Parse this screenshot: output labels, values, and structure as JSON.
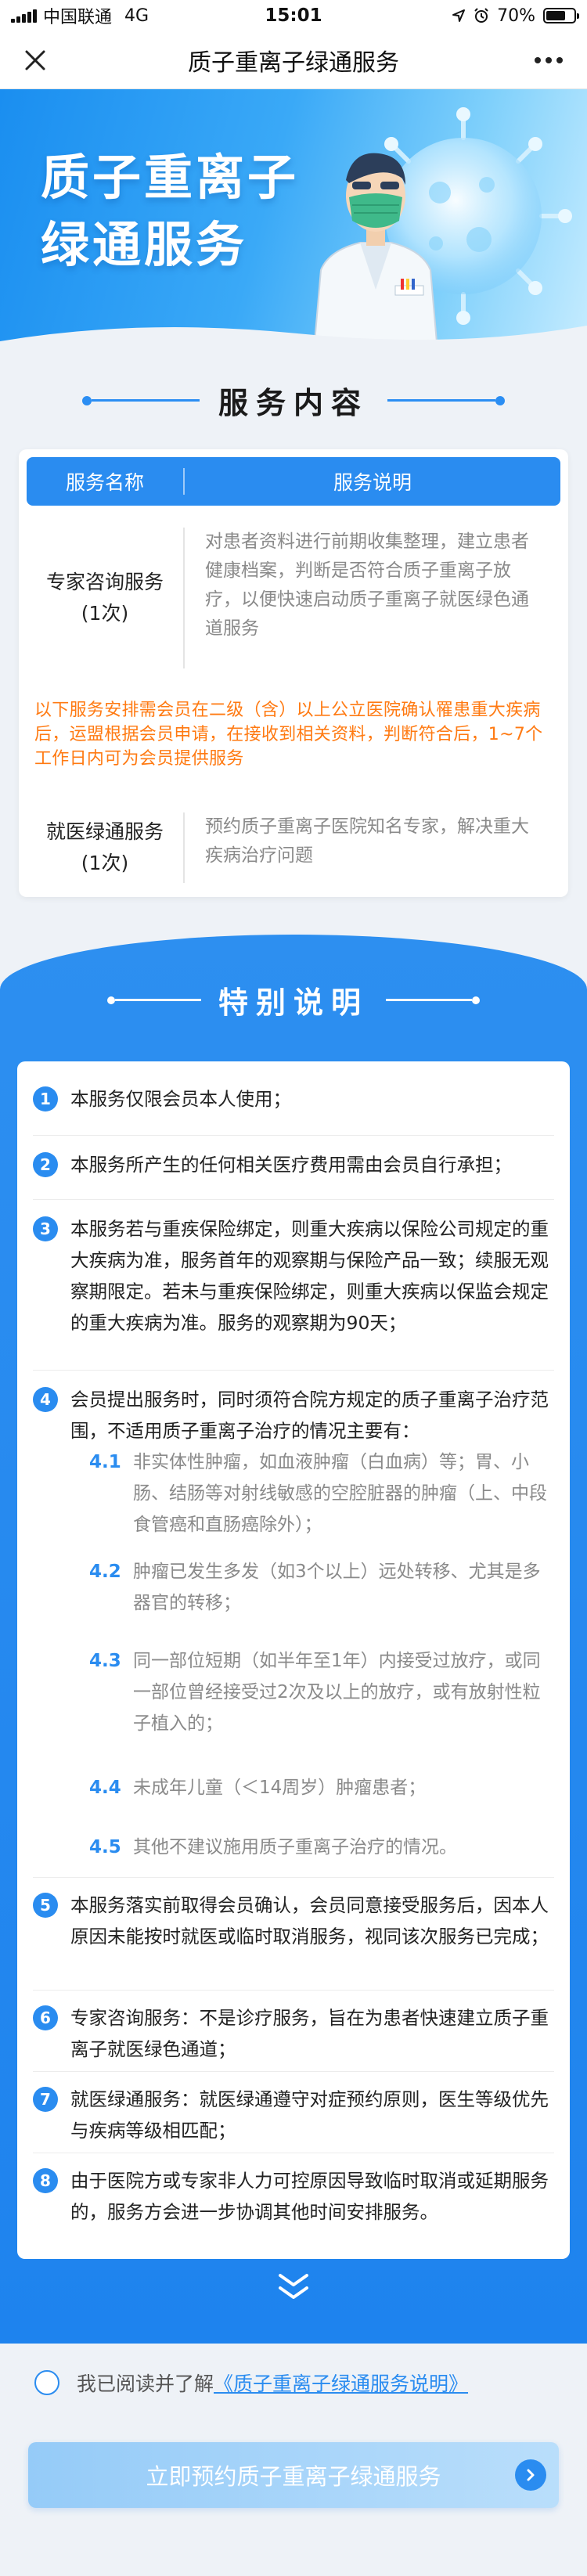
{
  "status_bar": {
    "carrier": "中国联通",
    "network": "4G",
    "time": "15:01",
    "battery": "70%",
    "battery_level": 0.7
  },
  "navbar": {
    "title": "质子重离子绿通服务",
    "close_icon": "close-icon",
    "more_icon": "more-icon"
  },
  "banner": {
    "line1": "质子重离子",
    "line2": "绿通服务"
  },
  "service_section": {
    "title": "服务内容",
    "table_headers": [
      "服务名称",
      "服务说明"
    ],
    "rows": [
      {
        "name": "专家咨询服务",
        "count": "(1次)",
        "desc": "对患者资料进行前期收集整理，建立患者健康档案，判断是否符合质子重离子放疗，以便快速启动质子重离子就医绿色通道服务"
      },
      {
        "name": "就医绿通服务",
        "count": "(1次)",
        "desc": "预约质子重离子医院知名专家，解决重大疾病治疗问题"
      }
    ],
    "note": "以下服务安排需会员在二级（含）以上公立医院确认罹患重大疾病后，运盟根据会员申请，在接收到相关资料，判断符合后，1~7个工作日内可为会员提供服务"
  },
  "special_section": {
    "title": "特别说明",
    "items": [
      {
        "num": "1",
        "text": "本服务仅限会员本人使用；"
      },
      {
        "num": "2",
        "text": "本服务所产生的任何相关医疗费用需由会员自行承担；"
      },
      {
        "num": "3",
        "text": "本服务若与重疾保险绑定，则重大疾病以保险公司规定的重大疾病为准，服务首年的观察期与保险产品一致；续服无观察期限定。若未与重疾保险绑定，则重大疾病以保监会规定的重大疾病为准。服务的观察期为90天；"
      },
      {
        "num": "4",
        "text": "会员提出服务时，同时须符合院方规定的质子重离子治疗范围，不适用质子重离子治疗的情况主要有："
      },
      {
        "num": "5",
        "text": "本服务落实前取得会员确认，会员同意接受服务后，因本人原因未能按时就医或临时取消服务，视同该次服务已完成；"
      },
      {
        "num": "6",
        "text": "专家咨询服务：不是诊疗服务，旨在为患者快速建立质子重离子就医绿色通道；"
      },
      {
        "num": "7",
        "text": "就医绿通服务：就医绿通遵守对症预约原则，医生等级优先与疾病等级相匹配；"
      },
      {
        "num": "8",
        "text": "由于医院方或专家非人力可控原因导致临时取消或延期服务的，服务方会进一步协调其他时间安排服务。"
      }
    ],
    "subitems": [
      {
        "num": "4.1",
        "text": "非实体性肿瘤，如血液肿瘤（白血病）等；胃、小肠、结肠等对射线敏感的空腔脏器的肿瘤（上、中段食管癌和直肠癌除外）；"
      },
      {
        "num": "4.2",
        "text": "肿瘤已发生多发（如3个以上）远处转移、尤其是多器官的转移；"
      },
      {
        "num": "4.3",
        "text": "同一部位短期（如半年至1年）内接受过放疗，或同一部位曾经接受过2次及以上的放疗，或有放射性粒子植入的；"
      },
      {
        "num": "4.4",
        "text": "未成年儿童（＜14周岁）肿瘤患者；"
      },
      {
        "num": "4.5",
        "text": "其他不建议施用质子重离子治疗的情况。"
      }
    ]
  },
  "agreement": {
    "prefix": "我已阅读并了解",
    "link": "《质子重离子绿通服务说明》"
  },
  "cta": {
    "label": "立即预约质子重离子绿通服务"
  },
  "colors": {
    "primary": "#2a8cf0",
    "note": "#ff7a12",
    "cta_bg": "#a7d4f9"
  }
}
